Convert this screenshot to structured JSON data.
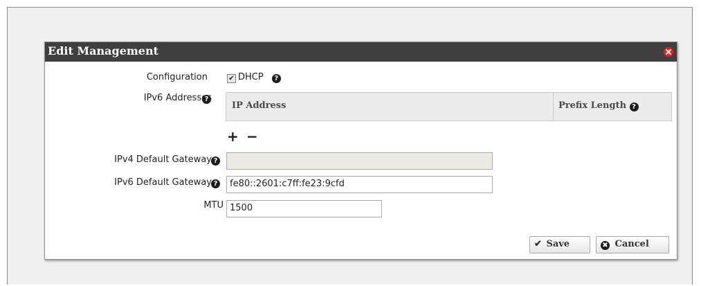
{
  "dialog": {
    "title": "Edit Management"
  },
  "form": {
    "configuration_label": "Configuration",
    "dhcp_label": "DHCP",
    "dhcp_checked": true,
    "ipv6_addresses_label": "IPv6 Addresses",
    "table": {
      "columns": [
        "IP Address",
        "Prefix Length"
      ]
    },
    "ipv4_gateway_label": "IPv4 Default Gateway",
    "ipv4_gateway_value": "",
    "ipv6_gateway_label": "IPv6 Default Gateway",
    "ipv6_gateway_value": "fe80::2601:c7ff:fe23:9cfd",
    "mtu_label": "MTU",
    "mtu_value": "1500"
  },
  "buttons": {
    "save_label": "Save",
    "cancel_label": "Cancel"
  },
  "icons": {
    "help": "?",
    "add": "+",
    "remove": "−",
    "check": "✔",
    "cancel": "✖",
    "checkbox": "✔"
  },
  "colors": {
    "titlebar": "#3f3f3f",
    "close": "#e81e1e"
  }
}
